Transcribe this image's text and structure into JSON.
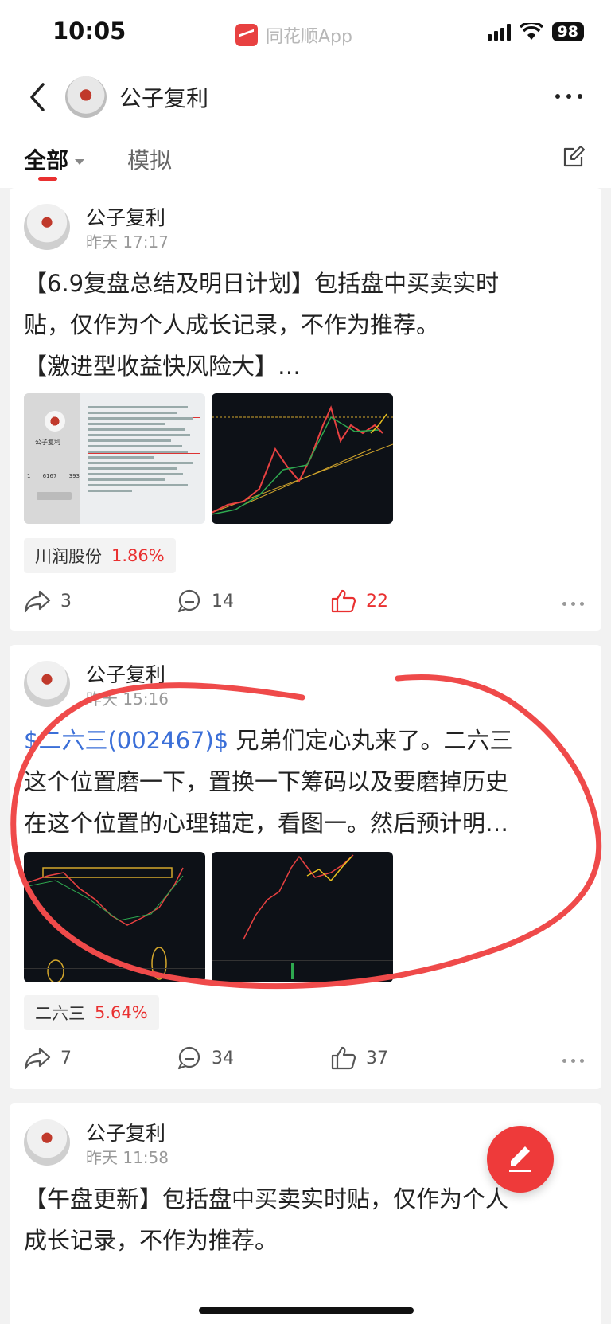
{
  "status_bar": {
    "time": "10:05",
    "app_name": "同花顺App",
    "battery": "98"
  },
  "header": {
    "title": "公子复利"
  },
  "tabs": [
    {
      "label": "全部",
      "active": true
    },
    {
      "label": "模拟",
      "active": false
    }
  ],
  "posts": [
    {
      "author": "公子复利",
      "time": "昨天 17:17",
      "text_lines": [
        "【6.9复盘总结及明日计划】包括盘中买卖实时",
        "贴，仅作为个人成长记录，不作为推荐。",
        "【激进型收益快风险大】…"
      ],
      "tag": {
        "name": "川润股份",
        "change": "1.86%"
      },
      "shares": "3",
      "comments": "14",
      "likes": "22",
      "liked": true
    },
    {
      "author": "公子复利",
      "time": "昨天 15:16",
      "stock_link": "$二六三(002467)$",
      "text_first_rest": " 兄弟们定心丸来了。二六三",
      "text_lines": [
        "这个位置磨一下，置换一下筹码以及要磨掉历史",
        "在这个位置的心理锚定，看图一。然后预计明…"
      ],
      "tag": {
        "name": "二六三",
        "change": "5.64%"
      },
      "shares": "7",
      "comments": "34",
      "likes": "37",
      "liked": false
    },
    {
      "author": "公子复利",
      "time": "昨天 11:58",
      "text_lines": [
        "【午盘更新】包括盘中买卖实时贴，仅作为个人",
        "成长记录，不作为推荐。"
      ]
    }
  ],
  "profile_thumb": {
    "name": "公子复利",
    "stats": [
      "1",
      "6167",
      "393"
    ]
  },
  "colors": {
    "accent": "#e93030",
    "link": "#3b6fd8",
    "annotation": "#ef4a4a"
  }
}
